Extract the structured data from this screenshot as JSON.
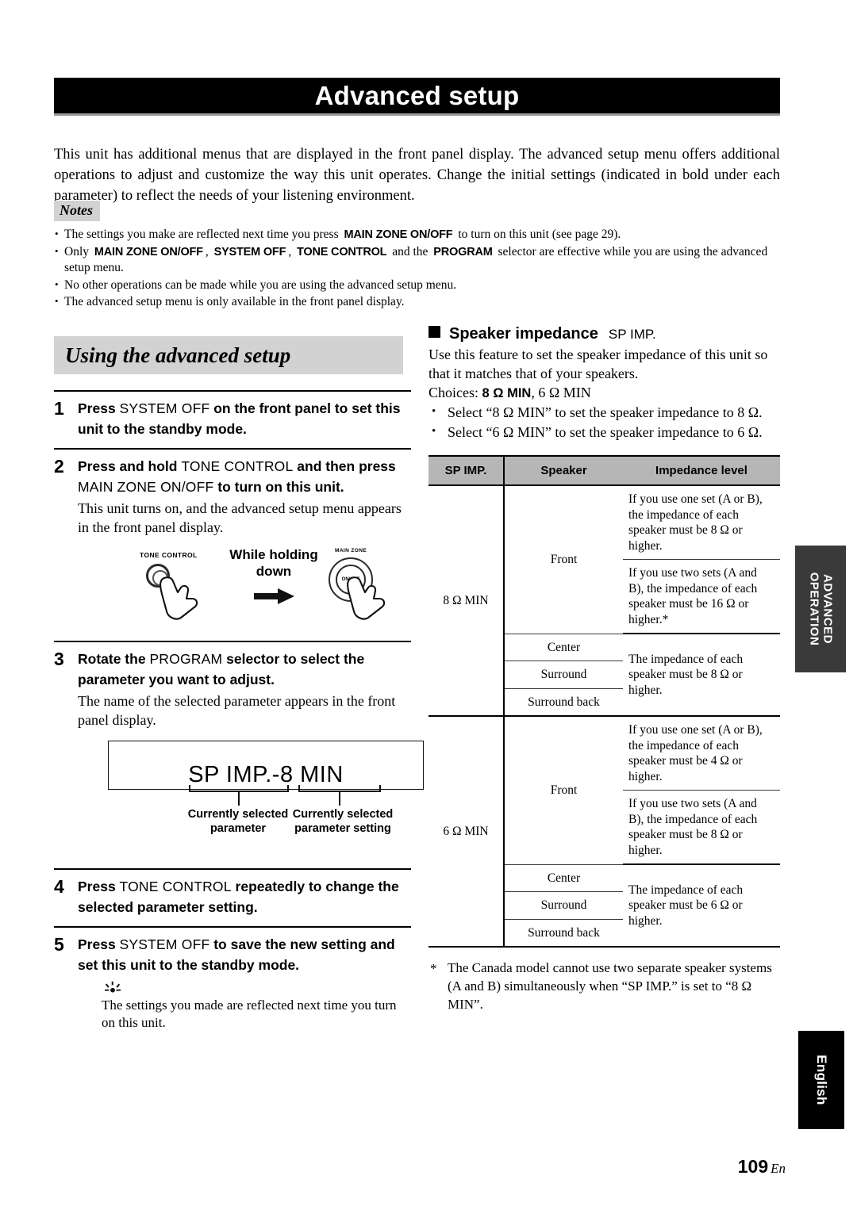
{
  "header": {
    "title": "Advanced setup"
  },
  "intro": "This unit has additional menus that are displayed in the front panel display. The advanced setup menu offers additional operations to adjust and customize the way this unit operates. Change the initial settings (indicated in bold under each parameter) to reflect the needs of your listening environment.",
  "notes": {
    "badge": "Notes",
    "items": [
      {
        "parts": [
          {
            "t": "The settings you make are reflected next time you press ",
            "b": false
          },
          {
            "t": "MAIN ZONE ON/OFF",
            "b": true
          },
          {
            "t": " to turn on this unit (see page 29).",
            "b": false
          }
        ]
      },
      {
        "parts": [
          {
            "t": "Only ",
            "b": false
          },
          {
            "t": "MAIN ZONE ON/OFF",
            "b": true
          },
          {
            "t": ", ",
            "b": false
          },
          {
            "t": "SYSTEM OFF",
            "b": true
          },
          {
            "t": ", ",
            "b": false
          },
          {
            "t": "TONE CONTROL",
            "b": true
          },
          {
            "t": " and the ",
            "b": false
          },
          {
            "t": "PROGRAM",
            "b": true
          },
          {
            "t": " selector are effective while you are using the advanced setup menu.",
            "b": false
          }
        ]
      },
      {
        "parts": [
          {
            "t": "No other operations can be made while you are using the advanced setup menu.",
            "b": false
          }
        ]
      },
      {
        "parts": [
          {
            "t": "The advanced setup menu is only available in the front panel display.",
            "b": false
          }
        ]
      }
    ]
  },
  "section": {
    "heading": "Using the advanced setup",
    "steps": [
      {
        "num": "1",
        "title_parts": [
          {
            "t": "Press ",
            "style": "bold"
          },
          {
            "t": "SYSTEM OFF",
            "style": "plain"
          },
          {
            "t": " on the front panel to set this unit to the standby mode.",
            "style": "bold"
          }
        ],
        "desc": ""
      },
      {
        "num": "2",
        "title_parts": [
          {
            "t": "Press and hold ",
            "style": "bold"
          },
          {
            "t": "TONE CONTROL",
            "style": "plain"
          },
          {
            "t": " and then press ",
            "style": "bold"
          },
          {
            "t": "MAIN ZONE ON/OFF",
            "style": "plain"
          },
          {
            "t": " to turn on this unit.",
            "style": "bold"
          }
        ],
        "desc": "This unit turns on, and the advanced setup menu appears in the front panel display."
      },
      {
        "num": "3",
        "title_parts": [
          {
            "t": "Rotate the ",
            "style": "bold"
          },
          {
            "t": "PROGRAM",
            "style": "plain"
          },
          {
            "t": " selector to select the parameter you want to adjust.",
            "style": "bold"
          }
        ],
        "desc": "The name of the selected parameter appears in the front panel display."
      },
      {
        "num": "4",
        "title_parts": [
          {
            "t": "Press ",
            "style": "bold"
          },
          {
            "t": "TONE CONTROL",
            "style": "plain"
          },
          {
            "t": " repeatedly to change the selected parameter setting.",
            "style": "bold"
          }
        ],
        "desc": ""
      },
      {
        "num": "5",
        "title_parts": [
          {
            "t": "Press ",
            "style": "bold"
          },
          {
            "t": "SYSTEM OFF",
            "style": "plain"
          },
          {
            "t": " to save the new setting and set this unit to the standby mode.",
            "style": "bold"
          }
        ],
        "desc": ""
      }
    ],
    "press_diagram": {
      "tone_label": "TONE CONTROL",
      "while_holding": "While holding\ndown",
      "main_zone_label": "MAIN ZONE",
      "onoff_label": "ON/OFF"
    },
    "display_figure": {
      "display_text": "SP IMP.-8 MIN",
      "caption_left": "Currently selected\nparameter",
      "caption_right": "Currently selected\nparameter setting"
    },
    "tip": "The settings you made are reflected next time you turn on this unit."
  },
  "speaker_impedance": {
    "heading": "Speaker impedance",
    "code": "SP IMP.",
    "description": "Use this feature to set the speaker impedance of this unit so that it matches that of your speakers.",
    "choices_label": "Choices:",
    "choices_bold": "8 Ω MIN",
    "choices_rest": ", 6 Ω MIN",
    "bullets": [
      "Select “8 Ω MIN” to set the speaker impedance to 8 Ω.",
      "Select “6 Ω MIN” to set the speaker impedance to 6 Ω."
    ],
    "table": {
      "headers": [
        "SP IMP.",
        "Speaker",
        "Impedance level"
      ],
      "groups": [
        {
          "sp_imp": "8 Ω MIN",
          "front_label": "Front",
          "front_levels": [
            "If you use one set (A or B), the impedance of each speaker must be 8 Ω or higher.",
            "If you use two sets (A and B), the impedance of each speaker must be 16 Ω or higher.*"
          ],
          "other_speakers": [
            "Center",
            "Surround",
            "Surround back"
          ],
          "other_level": "The impedance of each speaker must be 8 Ω or higher."
        },
        {
          "sp_imp": "6 Ω MIN",
          "front_label": "Front",
          "front_levels": [
            "If you use one set (A or B), the impedance of each speaker must be 4 Ω or higher.",
            "If you use two sets (A and B), the impedance of each speaker must be 8 Ω or higher."
          ],
          "other_speakers": [
            "Center",
            "Surround",
            "Surround back"
          ],
          "other_level": "The impedance of each speaker must be 6 Ω or higher."
        }
      ]
    },
    "footnote_marker": "*",
    "footnote": "The Canada model cannot use two separate speaker systems (A and B) simultaneously when “SP IMP.” is set to “8 Ω MIN”."
  },
  "side_tabs": {
    "advanced_operation": "ADVANCED OPERATION",
    "language": "English"
  },
  "footer": {
    "page_number": "109",
    "lang_suffix": "En"
  }
}
